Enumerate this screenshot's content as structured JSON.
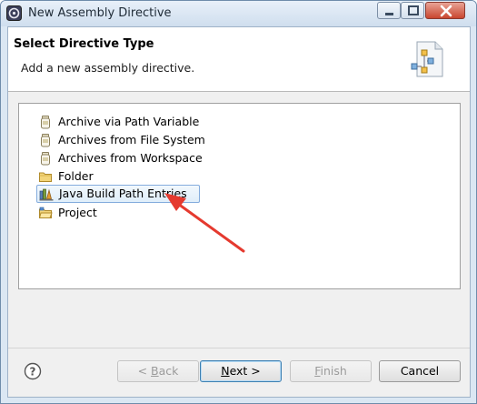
{
  "window": {
    "title": "New Assembly Directive"
  },
  "header": {
    "title": "Select Directive Type",
    "description": "Add a new assembly directive."
  },
  "directives": [
    {
      "label": "Archive via Path Variable",
      "icon": "jar-icon",
      "selected": false
    },
    {
      "label": "Archives from File System",
      "icon": "jar-icon",
      "selected": false
    },
    {
      "label": "Archives from Workspace",
      "icon": "jar-icon",
      "selected": false
    },
    {
      "label": "Folder",
      "icon": "folder-icon",
      "selected": false
    },
    {
      "label": "Java Build Path Entries",
      "icon": "library-icon",
      "selected": true
    },
    {
      "label": "Project",
      "icon": "project-folder-icon",
      "selected": false
    }
  ],
  "buttons": {
    "back": "< Back",
    "next": "Next >",
    "finish": "Finish",
    "cancel": "Cancel"
  },
  "annotation": {
    "arrow_color": "#e53a2f"
  }
}
